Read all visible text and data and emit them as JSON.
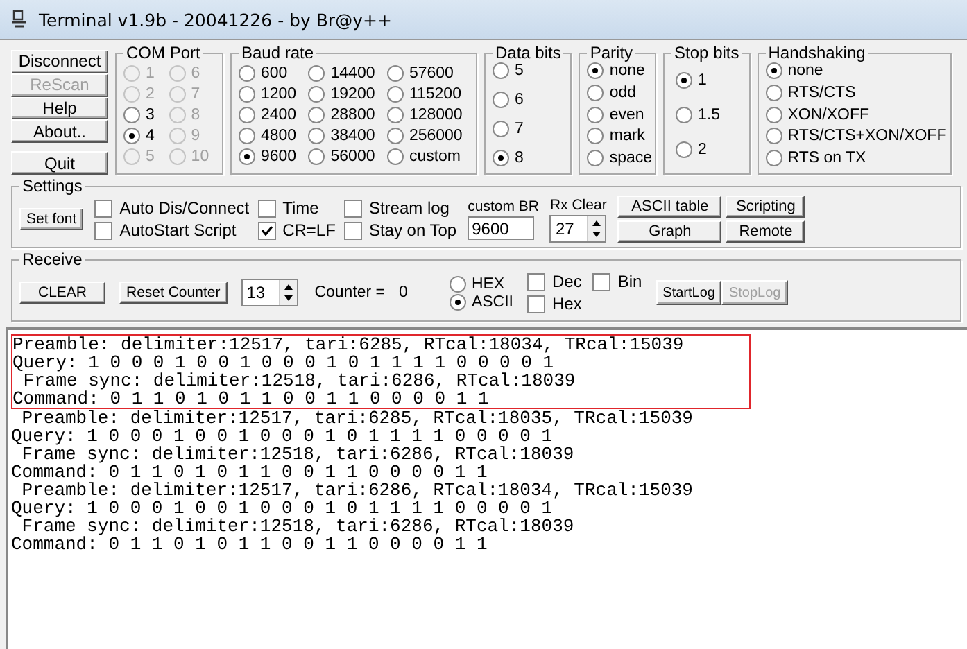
{
  "window": {
    "title": "Terminal v1.9b - 20041226 - by Br@y++"
  },
  "side_buttons": [
    {
      "label": "Disconnect",
      "disabled": false
    },
    {
      "label": "ReScan",
      "disabled": true
    },
    {
      "label": "Help",
      "disabled": false
    },
    {
      "label": "About..",
      "disabled": false
    },
    {
      "label": "Quit",
      "disabled": false
    }
  ],
  "com_port": {
    "title": "COM Port",
    "options": [
      {
        "label": "1",
        "selected": false,
        "disabled": true
      },
      {
        "label": "2",
        "selected": false,
        "disabled": true
      },
      {
        "label": "3",
        "selected": false,
        "disabled": false
      },
      {
        "label": "4",
        "selected": true,
        "disabled": false
      },
      {
        "label": "5",
        "selected": false,
        "disabled": true
      },
      {
        "label": "6",
        "selected": false,
        "disabled": true
      },
      {
        "label": "7",
        "selected": false,
        "disabled": true
      },
      {
        "label": "8",
        "selected": false,
        "disabled": true
      },
      {
        "label": "9",
        "selected": false,
        "disabled": true
      },
      {
        "label": "10",
        "selected": false,
        "disabled": true
      }
    ]
  },
  "baud_rate": {
    "title": "Baud rate",
    "options": [
      {
        "label": "600",
        "selected": false
      },
      {
        "label": "1200",
        "selected": false
      },
      {
        "label": "2400",
        "selected": false
      },
      {
        "label": "4800",
        "selected": false
      },
      {
        "label": "9600",
        "selected": true
      },
      {
        "label": "14400",
        "selected": false
      },
      {
        "label": "19200",
        "selected": false
      },
      {
        "label": "28800",
        "selected": false
      },
      {
        "label": "38400",
        "selected": false
      },
      {
        "label": "56000",
        "selected": false
      },
      {
        "label": "57600",
        "selected": false
      },
      {
        "label": "115200",
        "selected": false
      },
      {
        "label": "128000",
        "selected": false
      },
      {
        "label": "256000",
        "selected": false
      },
      {
        "label": "custom",
        "selected": false
      }
    ]
  },
  "data_bits": {
    "title": "Data bits",
    "options": [
      {
        "label": "5",
        "selected": false
      },
      {
        "label": "6",
        "selected": false
      },
      {
        "label": "7",
        "selected": false
      },
      {
        "label": "8",
        "selected": true
      }
    ]
  },
  "parity": {
    "title": "Parity",
    "options": [
      {
        "label": "none",
        "selected": true
      },
      {
        "label": "odd",
        "selected": false
      },
      {
        "label": "even",
        "selected": false
      },
      {
        "label": "mark",
        "selected": false
      },
      {
        "label": "space",
        "selected": false
      }
    ]
  },
  "stop_bits": {
    "title": "Stop bits",
    "options": [
      {
        "label": "1",
        "selected": true
      },
      {
        "label": "1.5",
        "selected": false
      },
      {
        "label": "2",
        "selected": false
      }
    ]
  },
  "handshaking": {
    "title": "Handshaking",
    "options": [
      {
        "label": "none",
        "selected": true
      },
      {
        "label": "RTS/CTS",
        "selected": false
      },
      {
        "label": "XON/XOFF",
        "selected": false
      },
      {
        "label": "RTS/CTS+XON/XOFF",
        "selected": false
      },
      {
        "label": "RTS on TX",
        "selected": false
      }
    ]
  },
  "settings": {
    "title": "Settings",
    "set_font": "Set font",
    "checkboxes": [
      {
        "label": "Auto Dis/Connect",
        "checked": false
      },
      {
        "label": "AutoStart Script",
        "checked": false
      },
      {
        "label": "Time",
        "checked": false
      },
      {
        "label": "CR=LF",
        "checked": true
      },
      {
        "label": "Stream log",
        "checked": false
      },
      {
        "label": "Stay on Top",
        "checked": false
      }
    ],
    "custom_br": {
      "label": "custom BR",
      "value": "9600"
    },
    "rx_clear": {
      "label": "Rx Clear",
      "value": "27"
    },
    "buttons": [
      "ASCII table",
      "Scripting",
      "Graph",
      "Remote"
    ]
  },
  "receive": {
    "title": "Receive",
    "clear": "CLEAR",
    "reset_counter": "Reset Counter",
    "counter_spin": "13",
    "counter_label": "Counter =",
    "counter_value": "0",
    "modes": [
      {
        "label": "HEX",
        "selected": false
      },
      {
        "label": "ASCII",
        "selected": true
      }
    ],
    "checkboxes": [
      {
        "label": "Dec",
        "checked": false
      },
      {
        "label": "Hex",
        "checked": false
      },
      {
        "label": "Bin",
        "checked": false
      }
    ],
    "start_log": {
      "label": "StartLog",
      "disabled": false
    },
    "stop_log": {
      "label": "StopLog",
      "disabled": true
    }
  },
  "log": {
    "highlighted_lines": [
      "Preamble: delimiter:12517, tari:6285, RTcal:18034, TRcal:15039",
      "Query: 1 0 0 0 1 0 0 1 0 0 0 1 0 1 1 1 1 0 0 0 0 1",
      " Frame sync: delimiter:12518, tari:6286, RTcal:18039",
      "Command: 0 1 1 0 1 0 1 1 0 0 1 1 0 0 0 0 1 1"
    ],
    "lines": [
      " Preamble: delimiter:12517, tari:6285, RTcal:18035, TRcal:15039",
      "Query: 1 0 0 0 1 0 0 1 0 0 0 1 0 1 1 1 1 0 0 0 0 1",
      " Frame sync: delimiter:12518, tari:6286, RTcal:18039",
      "Command: 0 1 1 0 1 0 1 1 0 0 1 1 0 0 0 0 1 1",
      " Preamble: delimiter:12517, tari:6286, RTcal:18034, TRcal:15039",
      "Query: 1 0 0 0 1 0 0 1 0 0 0 1 0 1 1 1 1 0 0 0 0 1",
      " Frame sync: delimiter:12518, tari:6286, RTcal:18039",
      "Command: 0 1 1 0 1 0 1 1 0 0 1 1 0 0 0 0 1 1"
    ]
  }
}
